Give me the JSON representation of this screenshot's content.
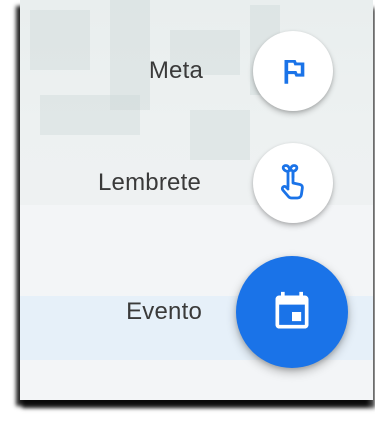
{
  "speed_dial": {
    "actions": [
      {
        "label": "Meta",
        "icon": "flag-icon"
      },
      {
        "label": "Lembrete",
        "icon": "reminder-hand-icon"
      },
      {
        "label": "Evento",
        "icon": "calendar-event-icon"
      }
    ]
  },
  "colors": {
    "accent": "#1a73e8",
    "label_text": "#3a3a3a",
    "mini_fab_bg": "#ffffff",
    "screen_bg": "#f3f5f7"
  }
}
